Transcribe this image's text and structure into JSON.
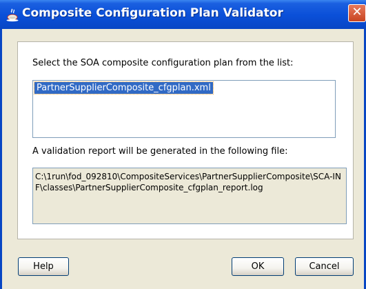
{
  "window": {
    "title": "Composite Configuration Plan Validator",
    "close_glyph": "✕",
    "title_icon": "java-cup-icon"
  },
  "main": {
    "select_label": "Select the SOA composite configuration plan from the list:",
    "plans": [
      "PartnerSupplierComposite_cfgplan.xml"
    ],
    "selected_plan": "PartnerSupplierComposite_cfgplan.xml",
    "report_label": "A validation report will be generated in the following file:",
    "report_path": "C:\\1run\\fod_092810\\CompositeServices\\PartnerSupplierComposite\\SCA-INF\\classes\\PartnerSupplierComposite_cfgplan_report.log"
  },
  "buttons": {
    "help": "Help",
    "ok": "OK",
    "cancel": "Cancel"
  },
  "colors": {
    "titlebar": "#0a4fd8",
    "selection": "#316ac5",
    "dialog_bg": "#ece9d8"
  }
}
